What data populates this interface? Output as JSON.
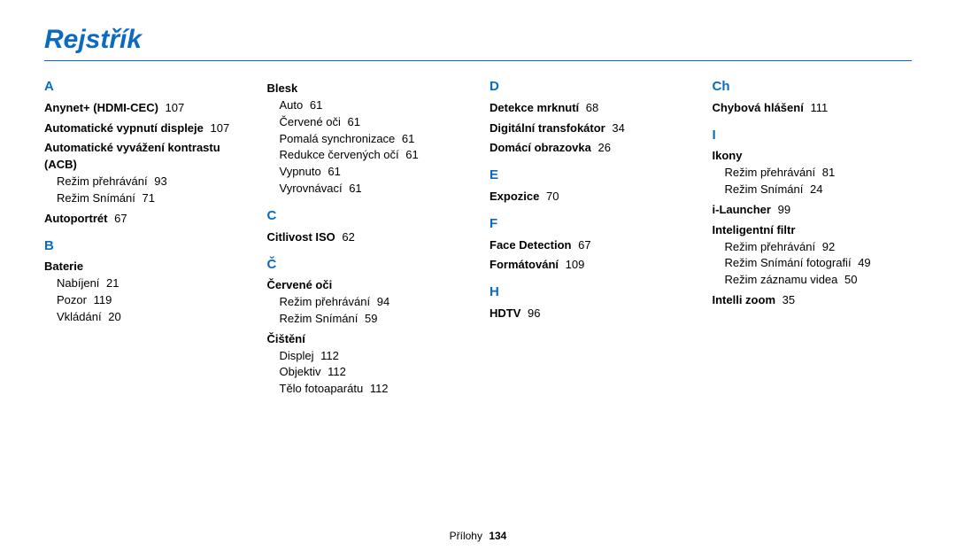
{
  "title": "Rejstřík",
  "footer": {
    "section": "Přílohy",
    "page": "134"
  },
  "columns": [
    [
      {
        "t": "letter",
        "v": "A",
        "first": true
      },
      {
        "t": "headline",
        "v": "Anynet+ (HDMI-CEC)",
        "pg": "107"
      },
      {
        "t": "headline",
        "v": "Automatické vypnutí displeje",
        "pg": "107"
      },
      {
        "t": "head",
        "v": "Automatické vyvážení kontrastu (ACB)"
      },
      {
        "t": "sub",
        "v": "Režim přehrávání",
        "pg": "93"
      },
      {
        "t": "sub",
        "v": "Režim Snímání",
        "pg": "71"
      },
      {
        "t": "headline",
        "v": "Autoportrét",
        "pg": "67"
      },
      {
        "t": "letter",
        "v": "B"
      },
      {
        "t": "head",
        "v": "Baterie"
      },
      {
        "t": "sub",
        "v": "Nabíjení",
        "pg": "21"
      },
      {
        "t": "sub",
        "v": "Pozor",
        "pg": "119"
      },
      {
        "t": "sub",
        "v": "Vkládání",
        "pg": "20"
      }
    ],
    [
      {
        "t": "head",
        "v": "Blesk",
        "first": true
      },
      {
        "t": "sub",
        "v": "Auto",
        "pg": "61"
      },
      {
        "t": "sub",
        "v": "Červené oči",
        "pg": "61"
      },
      {
        "t": "sub",
        "v": "Pomalá synchronizace",
        "pg": "61"
      },
      {
        "t": "sub",
        "v": "Redukce červených očí",
        "pg": "61"
      },
      {
        "t": "sub",
        "v": "Vypnuto",
        "pg": "61"
      },
      {
        "t": "sub",
        "v": "Vyrovnávací",
        "pg": "61"
      },
      {
        "t": "letter",
        "v": "C"
      },
      {
        "t": "headline",
        "v": "Citlivost ISO",
        "pg": "62"
      },
      {
        "t": "letter",
        "v": "Č"
      },
      {
        "t": "head",
        "v": "Červené oči"
      },
      {
        "t": "sub",
        "v": "Režim přehrávání",
        "pg": "94"
      },
      {
        "t": "sub",
        "v": "Režim Snímání",
        "pg": "59"
      },
      {
        "t": "head",
        "v": "Čištění"
      },
      {
        "t": "sub",
        "v": "Displej",
        "pg": "112"
      },
      {
        "t": "sub",
        "v": "Objektiv",
        "pg": "112"
      },
      {
        "t": "sub",
        "v": "Tělo fotoaparátu",
        "pg": "112"
      }
    ],
    [
      {
        "t": "letter",
        "v": "D",
        "first": true
      },
      {
        "t": "headline",
        "v": "Detekce mrknutí",
        "pg": "68"
      },
      {
        "t": "headline",
        "v": "Digitální transfokátor",
        "pg": "34"
      },
      {
        "t": "headline",
        "v": "Domácí obrazovka",
        "pg": "26"
      },
      {
        "t": "letter",
        "v": "E"
      },
      {
        "t": "headline",
        "v": "Expozice",
        "pg": "70"
      },
      {
        "t": "letter",
        "v": "F"
      },
      {
        "t": "headline",
        "v": "Face Detection",
        "pg": "67"
      },
      {
        "t": "headline",
        "v": "Formátování",
        "pg": "109"
      },
      {
        "t": "letter",
        "v": "H"
      },
      {
        "t": "headline",
        "v": "HDTV",
        "pg": "96"
      }
    ],
    [
      {
        "t": "letter",
        "v": "Ch",
        "first": true
      },
      {
        "t": "headline",
        "v": "Chybová hlášení",
        "pg": "111"
      },
      {
        "t": "letter",
        "v": "I"
      },
      {
        "t": "head",
        "v": "Ikony"
      },
      {
        "t": "sub",
        "v": "Režim přehrávání",
        "pg": "81"
      },
      {
        "t": "sub",
        "v": "Režim Snímání",
        "pg": "24"
      },
      {
        "t": "headline",
        "v": "i-Launcher",
        "pg": "99"
      },
      {
        "t": "head",
        "v": "Inteligentní filtr"
      },
      {
        "t": "sub",
        "v": "Režim přehrávání",
        "pg": "92"
      },
      {
        "t": "sub",
        "v": "Režim Snímání fotografií",
        "pg": "49"
      },
      {
        "t": "sub",
        "v": "Režim záznamu videa",
        "pg": "50"
      },
      {
        "t": "headline",
        "v": "Intelli zoom",
        "pg": "35"
      }
    ]
  ]
}
